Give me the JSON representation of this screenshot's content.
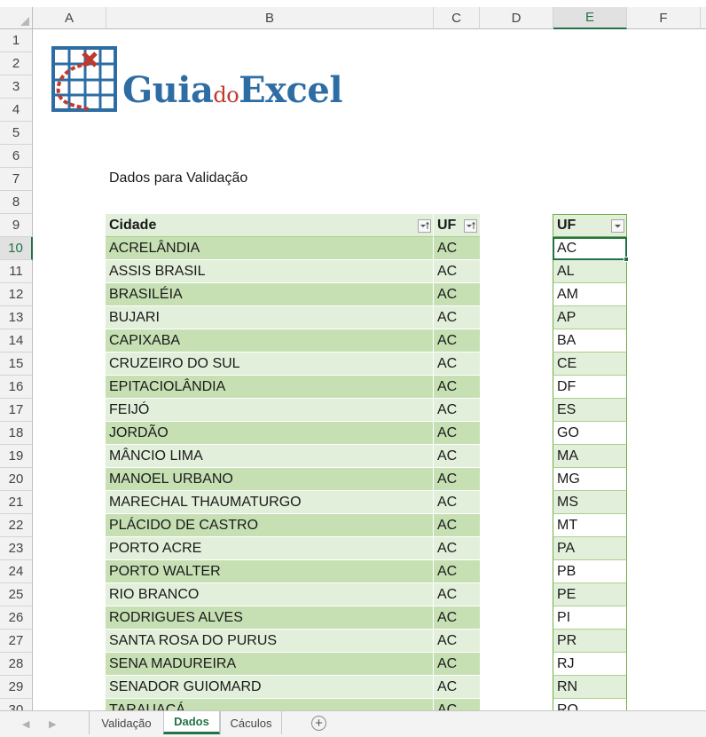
{
  "columns": [
    "A",
    "B",
    "C",
    "D",
    "E",
    "F"
  ],
  "rows": [
    "1",
    "2",
    "3",
    "4",
    "5",
    "6",
    "7",
    "8",
    "9",
    "10",
    "11",
    "12",
    "13",
    "14",
    "15",
    "16",
    "17",
    "18",
    "19",
    "20",
    "21",
    "22",
    "23",
    "24",
    "25",
    "26",
    "27",
    "28",
    "29",
    "30"
  ],
  "logo": {
    "text_guia": "Guia",
    "text_do": "do",
    "text_excel": "Excel"
  },
  "title": "Dados para Validação",
  "table": {
    "headers": {
      "cidade": "Cidade",
      "uf": "UF"
    },
    "rows": [
      {
        "cidade": "ACRELÂNDIA",
        "uf": "AC"
      },
      {
        "cidade": "ASSIS BRASIL",
        "uf": "AC"
      },
      {
        "cidade": "BRASILÉIA",
        "uf": "AC"
      },
      {
        "cidade": "BUJARI",
        "uf": "AC"
      },
      {
        "cidade": "CAPIXABA",
        "uf": "AC"
      },
      {
        "cidade": "CRUZEIRO DO SUL",
        "uf": "AC"
      },
      {
        "cidade": "EPITACIOLÂNDIA",
        "uf": "AC"
      },
      {
        "cidade": "FEIJÓ",
        "uf": "AC"
      },
      {
        "cidade": "JORDÃO",
        "uf": "AC"
      },
      {
        "cidade": "MÂNCIO LIMA",
        "uf": "AC"
      },
      {
        "cidade": "MANOEL URBANO",
        "uf": "AC"
      },
      {
        "cidade": "MARECHAL THAUMATURGO",
        "uf": "AC"
      },
      {
        "cidade": "PLÁCIDO DE CASTRO",
        "uf": "AC"
      },
      {
        "cidade": "PORTO ACRE",
        "uf": "AC"
      },
      {
        "cidade": "PORTO WALTER",
        "uf": "AC"
      },
      {
        "cidade": "RIO BRANCO",
        "uf": "AC"
      },
      {
        "cidade": "RODRIGUES ALVES",
        "uf": "AC"
      },
      {
        "cidade": "SANTA ROSA DO PURUS",
        "uf": "AC"
      },
      {
        "cidade": "SENA MADUREIRA",
        "uf": "AC"
      },
      {
        "cidade": "SENADOR GUIOMARD",
        "uf": "AC"
      },
      {
        "cidade": "TARAUACÁ",
        "uf": "AC"
      }
    ]
  },
  "uf_table": {
    "header": "UF",
    "values": [
      "AC",
      "AL",
      "AM",
      "AP",
      "BA",
      "CE",
      "DF",
      "ES",
      "GO",
      "MA",
      "MG",
      "MS",
      "MT",
      "PA",
      "PB",
      "PE",
      "PI",
      "PR",
      "RJ",
      "RN",
      "RO"
    ]
  },
  "tabs": {
    "items": [
      "Validação",
      "Dados",
      "Cáculos"
    ],
    "active": "Dados",
    "add_label": "+"
  },
  "colors": {
    "accent": "#217346",
    "table_dark": "#c6e0b4",
    "table_light": "#e2efda",
    "logo_blue": "#2e6da4",
    "logo_red": "#c0392b"
  }
}
